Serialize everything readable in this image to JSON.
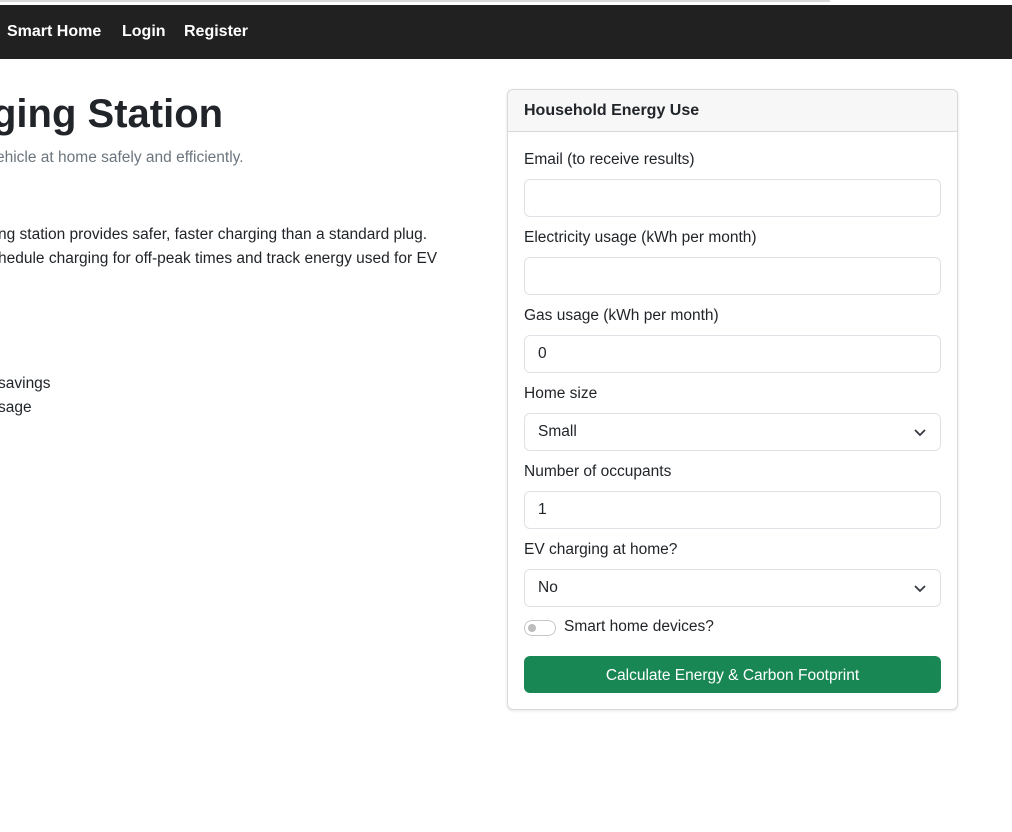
{
  "nav": {
    "smart_home": "Smart Home",
    "login": "Login",
    "register": "Register"
  },
  "hero": {
    "title": "ging Station",
    "subtitle": "ehicle at home safely and efficiently."
  },
  "body": {
    "para1_line1": "ng station provides safer, faster charging than a standard plug.",
    "para1_line2": "hedule charging for off-peak times and track energy used for EV",
    "list": [
      " savings",
      "sage"
    ]
  },
  "form": {
    "header": "Household Energy Use",
    "email_label": "Email (to receive results)",
    "email_value": "",
    "electricity_label": "Electricity usage (kWh per month)",
    "electricity_value": "",
    "gas_label": "Gas usage (kWh per month)",
    "gas_value": "0",
    "home_size_label": "Home size",
    "home_size_value": "Small",
    "occupants_label": "Number of occupants",
    "occupants_value": "1",
    "ev_label": "EV charging at home?",
    "ev_value": "No",
    "smart_devices_label": "Smart home devices?",
    "smart_devices_on": false,
    "submit_label": "Calculate Energy & Carbon Footprint"
  },
  "colors": {
    "navbar": "#212121",
    "primary_button": "#198754"
  }
}
